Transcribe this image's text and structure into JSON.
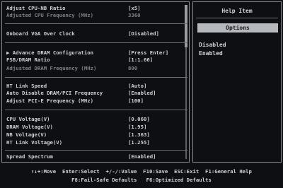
{
  "main": {
    "rows": [
      {
        "label": "Adjust CPU-NB Ratio",
        "value": "[x5]",
        "dim": false
      },
      {
        "label": "Adjusted CPU Frequency (MHz)",
        "value": "3360",
        "dim": true
      },
      {
        "label": "Onboard VGA Over Clock",
        "value": "[Disabled]",
        "dim": false
      },
      {
        "label": "▶ Advance DRAM Configuration",
        "value": "[Press Enter]",
        "dim": false
      },
      {
        "label": "FSB/DRAM Ratio",
        "value": "[1:1.66]",
        "dim": false
      },
      {
        "label": "Adjusted DRAM Frequency (MHz)",
        "value": "800",
        "dim": true
      },
      {
        "label": "HT Link Speed",
        "value": "[Auto]",
        "dim": false
      },
      {
        "label": "Auto Disable DRAM/PCI Frequency",
        "value": "[Enabled]",
        "dim": false
      },
      {
        "label": "Adjust PCI-E Frequency (MHz)",
        "value": "[100]",
        "dim": false
      },
      {
        "label": "CPU Voltage(V)",
        "value": "[0.060]",
        "dim": false
      },
      {
        "label": "DRAM Voltage(V)",
        "value": "[1.95]",
        "dim": false
      },
      {
        "label": "NB Voltage(V)",
        "value": "[1.363]",
        "dim": false
      },
      {
        "label": "HT Link Voltage(V)",
        "value": "[1.255]",
        "dim": false
      },
      {
        "label": "Spread Spectrum",
        "value": "[Enabled]",
        "dim": false
      }
    ]
  },
  "help": {
    "title": "Help Item",
    "options_label": "Options",
    "options": [
      "Disabled",
      "Enabled"
    ]
  },
  "footer": {
    "line1": "↑↓+:Move  Enter:Select  +/-/:Value  F10:Save  ESC:Exit  F1:General Help",
    "line2": "F8:Fail-Safe Defaults   F6:Optimized Defaults"
  }
}
